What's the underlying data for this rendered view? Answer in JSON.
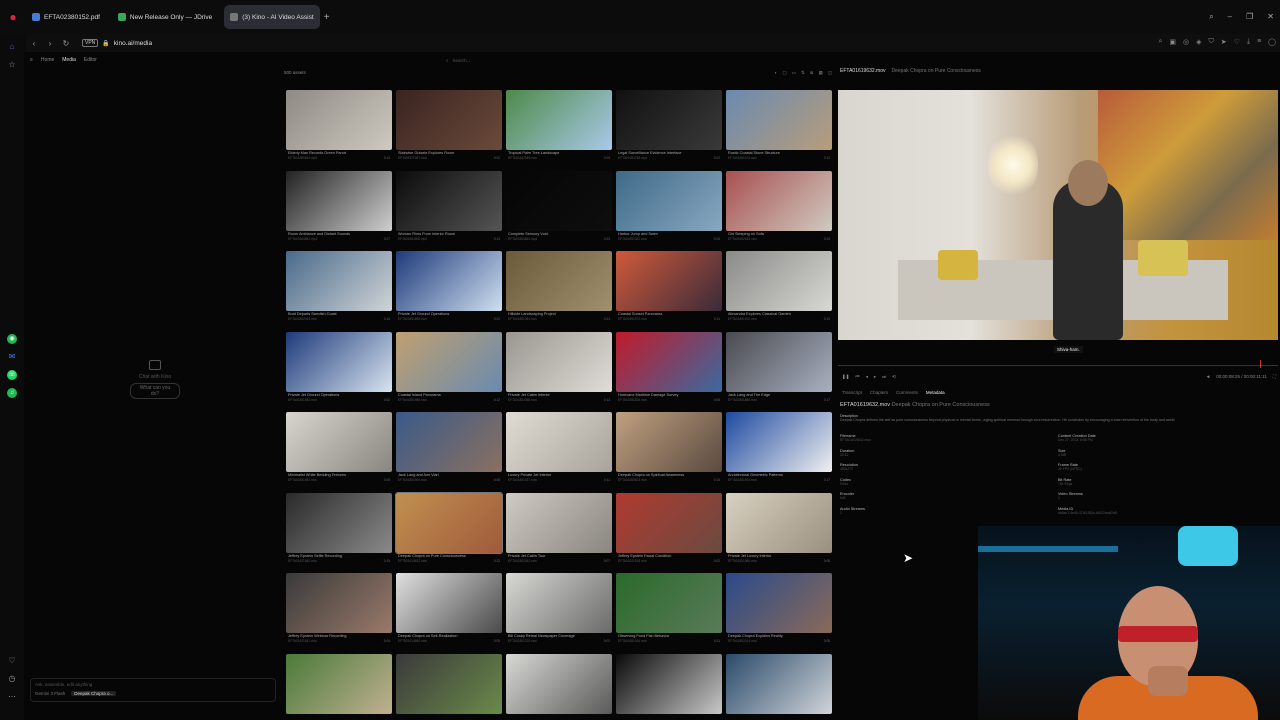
{
  "browser": {
    "tabs": [
      {
        "label": "EFTA02380152.pdf",
        "icon_color": "#4a7bd4",
        "active": false
      },
      {
        "label": "New Release Only — JDrive",
        "icon_color": "#3ba55c",
        "active": false
      },
      {
        "label": "(3) Kino - AI Video Assist",
        "icon_color": "#777777",
        "active": true
      }
    ],
    "new_tab": "+",
    "vpn": "VPN",
    "url": "kino.ai/media",
    "window_controls": [
      "⌕",
      "–",
      "❐",
      "✕"
    ]
  },
  "leftbar": {
    "icons": [
      "opera-logo",
      "home-icon",
      "star-icon",
      "chatgpt-icon",
      "messenger-icon",
      "whatsapp-icon",
      "spotify-icon",
      "heart-icon",
      "clock-icon",
      "more-icon"
    ]
  },
  "app": {
    "breadcrumb": [
      "Home",
      "Media",
      "Editor"
    ],
    "search_placeholder": "Search...",
    "chat": {
      "empty_text": "Chat with Kino",
      "prompt_pill": "What can you do?",
      "input_placeholder": "Ask, assemble, edit anything",
      "model": "Gemini 3 Flash",
      "context": "Deepak Chopra o..."
    },
    "asset_count": "500 assets"
  },
  "grid": [
    {
      "name": "Elderly Man Records Green Parrot",
      "file": "EFTA01869634.mp4",
      "dur": "0:14",
      "c1": "#8e8a84",
      "c2": "#cfcac0"
    },
    {
      "name": "Stairwise Guiseie Explores Room",
      "file": "EFTA01871967.mov",
      "dur": "0:02",
      "c1": "#3a2420",
      "c2": "#6b4a3a"
    },
    {
      "name": "Tropical Palm Tree Landscape",
      "file": "EFTA01842348.mov",
      "dur": "0:03",
      "c1": "#4d8a4a",
      "c2": "#a9c9e8"
    },
    {
      "name": "Legal Surveillance Evidence Interface",
      "file": "EFTA01984748.mp4",
      "dur": "0:02",
      "c1": "#111111",
      "c2": "#3a3a3a"
    },
    {
      "name": "Rustic Coastal Stone Structure",
      "file": "EFTA01851123.mov",
      "dur": "0:12",
      "c1": "#6a8ab0",
      "c2": "#b89d7c"
    },
    {
      "name": "Room Ambiance and Distant Sounds",
      "file": "EFTA01864852.mp4",
      "dur": "0:27",
      "c1": "#222222",
      "c2": "#cfcfcf"
    },
    {
      "name": "Woman Films From Interior Room",
      "file": "EFTA01864906.mp4",
      "dur": "0:14",
      "c1": "#0b0b0b",
      "c2": "#555555"
    },
    {
      "name": "Complete Sensory Void",
      "file": "EFTA01864864.mp4",
      "dur": "0:23",
      "c1": "#050505",
      "c2": "#0e0e0e"
    },
    {
      "name": "Harbor Jump and Swim",
      "file": "EFTA01851082.mov",
      "dur": "0:06",
      "c1": "#3d6a88",
      "c2": "#8aa8c0"
    },
    {
      "name": "Girl Sleeping on Sofa",
      "file": "EFTA01852185.mov",
      "dur": "0:24",
      "c1": "#a85050",
      "c2": "#cfcac0"
    },
    {
      "name": "Boat Departs Swedish Coast",
      "file": "EFTA01852063.mov",
      "dur": "0:16",
      "c1": "#4a6a8a",
      "c2": "#d0d4d8"
    },
    {
      "name": "Private Jet Ground Operations",
      "file": "EFTA01851898.mov",
      "dur": "0:02",
      "c1": "#1e3a7a",
      "c2": "#cfe0f0"
    },
    {
      "name": "Hillside Landscaping Project",
      "file": "EFTA01851084.mov",
      "dur": "0:11",
      "c1": "#6a5a3a",
      "c2": "#a09070"
    },
    {
      "name": "Coastal Sunset Panorama",
      "file": "EFTA01851972.mov",
      "dur": "0:11",
      "c1": "#d05a3a",
      "c2": "#3a2a3a"
    },
    {
      "name": "Alexandra Explores Classical Garden",
      "file": "EFTA01851912.mov",
      "dur": "0:10",
      "c1": "#8a8a88",
      "c2": "#d8d8d4"
    },
    {
      "name": "Private Jet Ground Operations",
      "file": "EFTA01851984.mov",
      "dur": "0:02",
      "c1": "#1e3a7a",
      "c2": "#d8e4f0"
    },
    {
      "name": "Coastal Island Panorama",
      "file": "EFTA01851988.mov",
      "dur": "0:12",
      "c1": "#c0a070",
      "c2": "#6a8ab0"
    },
    {
      "name": "Private Jet Cabin Interior",
      "file": "EFTA01852058.mov",
      "dur": "0:13",
      "c1": "#9a9690",
      "c2": "#e0ddd8"
    },
    {
      "name": "Hurricane Maritime Damage Survey",
      "file": "EFTA01851816.mov",
      "dur": "0:08",
      "c1": "#c01a2a",
      "c2": "#3a6aa0"
    },
    {
      "name": "Jack Lang and The Edge",
      "file": "EFTA01851886.mov",
      "dur": "0:17",
      "c1": "#4a4a50",
      "c2": "#a8b0c0"
    },
    {
      "name": "Minimalist White Bedding Textures",
      "file": "EFTA01851982.mov",
      "dur": "0:05",
      "c1": "#d8d4ce",
      "c2": "#8a8680"
    },
    {
      "name": "Jack Lang and Ami Viari",
      "file": "EFTA01851904.mov",
      "dur": "0:08",
      "c1": "#3a5a8a",
      "c2": "#8a7060"
    },
    {
      "name": "Luxury Private Jet Interior",
      "file": "EFTA01851937.mov",
      "dur": "0:11",
      "c1": "#e0dcd4",
      "c2": "#a8a49c"
    },
    {
      "name": "Deepak Chopra on Spiritual Awareness",
      "file": "EFTA01869623.mov",
      "dur": "0:15",
      "c1": "#c0a080",
      "c2": "#5a4a40"
    },
    {
      "name": "Architectural Geometric Patterns",
      "file": "EFTA01851901.mov",
      "dur": "0:17",
      "c1": "#1e4aa0",
      "c2": "#f0f0f0"
    },
    {
      "name": "Jeffrey Epstein Selfie Recording",
      "file": "EFTA01821540.mov",
      "dur": "0:15",
      "c1": "#2a2a2a",
      "c2": "#8a8a8a"
    },
    {
      "name": "Deepak Chopra on Pure Consciousness",
      "file": "EFTA01619632.mov",
      "dur": "0:22",
      "c1": "#c09050",
      "c2": "#a05a3a",
      "selected": true
    },
    {
      "name": "Private Jet Cabin Tour",
      "file": "EFTA01852052.mov",
      "dur": "0:07",
      "c1": "#cfcac2",
      "c2": "#8a8680"
    },
    {
      "name": "Jeffrey Epstein Facial Condition",
      "file": "EFTA01821518.mov",
      "dur": "0:02",
      "c1": "#b03a30",
      "c2": "#6a4a40"
    },
    {
      "name": "Private Jet Luxury Interior",
      "file": "EFTA01851986.mov",
      "dur": "0:08",
      "c1": "#d8d0c0",
      "c2": "#9a9080"
    },
    {
      "name": "Jeffrey Epstein Webinar Recording",
      "file": "EFTA01821541.mov",
      "dur": "0:04",
      "c1": "#3a3a3a",
      "c2": "#9a7a6a"
    },
    {
      "name": "Deepak Chopra on Self-Realization",
      "file": "EFTA01614680.mov",
      "dur": "0:05",
      "c1": "#e0e0e0",
      "c2": "#4a4a4a"
    },
    {
      "name": "Bill Cosby Retrial Newspaper Coverage",
      "file": "EFTA01851225.mov",
      "dur": "0:02",
      "c1": "#d8d8d4",
      "c2": "#6a6a6a"
    },
    {
      "name": "Observing Pond Fish Behavior",
      "file": "EFTA01851044.mov",
      "dur": "0:11",
      "c1": "#2a6a2a",
      "c2": "#5a7a5a"
    },
    {
      "name": "Deepak Chopra Explains Reality",
      "file": "EFTA01852014.mov",
      "dur": "0:08",
      "c1": "#2a4a8a",
      "c2": "#8a6a5a"
    },
    {
      "name": "",
      "file": "",
      "dur": "",
      "c1": "#4a7a3a",
      "c2": "#c0b090"
    },
    {
      "name": "",
      "file": "",
      "dur": "",
      "c1": "#3a3a3a",
      "c2": "#6a8a4a"
    },
    {
      "name": "",
      "file": "",
      "dur": "",
      "c1": "#d8d8d4",
      "c2": "#5a5a5a"
    },
    {
      "name": "",
      "file": "",
      "dur": "",
      "c1": "#0a0a0a",
      "c2": "#c8c8c8"
    },
    {
      "name": "",
      "file": "",
      "dur": "",
      "c1": "#2a4a6a",
      "c2": "#d0d4d8"
    }
  ],
  "preview": {
    "file": "EFTA01619632.mov",
    "title": "Deepak Chopra on Pure Consciousness",
    "caption": "Shiva-ham.",
    "timestamp": "00:00:08:25 / 00:00:11:11",
    "tabs": [
      "Transcript",
      "Chapters",
      "Comments",
      "Metadata"
    ],
    "active_tab": "Metadata",
    "description_label": "Description",
    "description": "Deepak Chopra defines the self as pure consciousness beyond physical or mental forms, urging spiritual renewal through soul resurrection. He concludes by encouraging a total reinvention of the body and world.",
    "fields": [
      {
        "label": "Filename",
        "value": "EFTA01619632.mov"
      },
      {
        "label": "Content Creation Date",
        "value": "Dec 27, 2013, 6:58 PM"
      },
      {
        "label": "Duration",
        "value": "00:11"
      },
      {
        "label": "Size",
        "value": "4 MB"
      },
      {
        "label": "Resolution",
        "value": "480x272"
      },
      {
        "label": "Frame Rate",
        "value": "25 FPS (NTSC)"
      },
      {
        "label": "Codec",
        "value": "H264"
      },
      {
        "label": "Bit Rate",
        "value": "781 Kbps"
      },
      {
        "label": "Encoder",
        "value": "N/A"
      },
      {
        "label": "Video Streams",
        "value": "1"
      },
      {
        "label": "Audio Streams",
        "value": "1"
      },
      {
        "label": "Media ID",
        "value": "db5ac1-4e45-4740-852e-6f522ceaf2a5"
      }
    ]
  }
}
